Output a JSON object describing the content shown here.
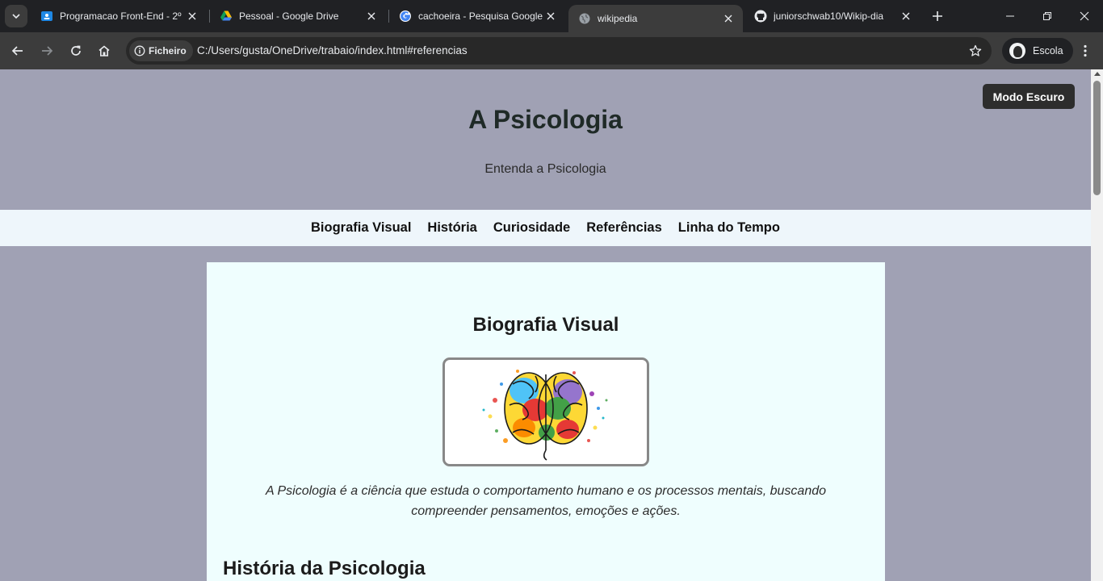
{
  "browser": {
    "tabs": [
      {
        "title": "Programacao Front-End - 2º",
        "favicon": "classroom-icon"
      },
      {
        "title": "Pessoal - Google Drive",
        "favicon": "google-drive-icon"
      },
      {
        "title": "cachoeira - Pesquisa Google",
        "favicon": "google-icon"
      },
      {
        "title": "wikipedia",
        "favicon": "globe-icon",
        "active": true
      },
      {
        "title": "juniorschwab10/Wikip-dia",
        "favicon": "github-icon"
      }
    ],
    "security_chip": "Ficheiro",
    "url": "C:/Users/gusta/OneDrive/trabaio/index.html#referencias",
    "profile_name": "Escola"
  },
  "page": {
    "dark_mode_button": "Modo Escuro",
    "title": "A Psicologia",
    "subtitle": "Entenda a Psicologia",
    "nav": [
      "Biografia Visual",
      "História",
      "Curiosidade",
      "Referências",
      "Linha do Tempo"
    ],
    "section1": {
      "heading": "Biografia Visual",
      "image_subject": "colorful-brain-illustration",
      "caption": "A Psicologia é a ciência que estuda o comportamento humano e os processos mentais, buscando compreender pensamentos, emoções e ações."
    },
    "section2_heading": "História da Psicologia"
  },
  "colors": {
    "page_bg": "#a0a1b4",
    "nav_bg": "#eef6fb",
    "card_bg": "#effefe",
    "dark_button": "#2d2d2d",
    "chrome_dark": "#202124",
    "chrome_toolbar": "#3c3c3c"
  }
}
